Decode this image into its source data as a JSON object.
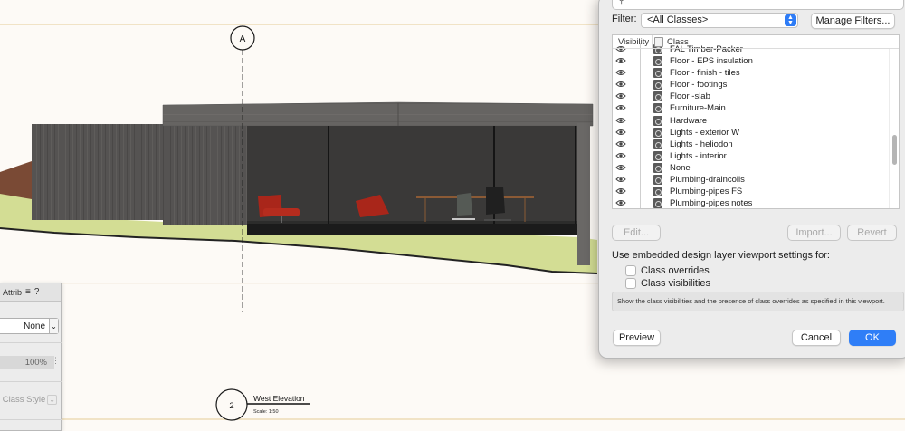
{
  "canvas": {
    "grid_bubble_label": "A",
    "view_marker_number": "2",
    "view_title": "West Elevation",
    "view_scale": "Scale: 1:50",
    "colors": {
      "background": "#fdfaf6",
      "guide_line": "#f1e3c6",
      "roof_concrete": "#646260",
      "wall_concrete": "#535150",
      "terrain_green": "#d3dd94",
      "terrain_brown": "#7a4a35",
      "chair_red": "#a9261a"
    }
  },
  "attributes_palette": {
    "title": "Attrib",
    "menu_icon": "hamburger-menu-icon",
    "help_label": "?",
    "fill_value": "None",
    "opacity_value": "100%",
    "class_style_label": "Class Style"
  },
  "dialog": {
    "filter_label": "Filter:",
    "filter_value": "<All Classes>",
    "manage_filters_label": "Manage Filters...",
    "list_header_visibility": "Visibility",
    "list_header_class": "Class",
    "classes": [
      {
        "name": "FAL Timber-Packer",
        "visible": true
      },
      {
        "name": "Floor - EPS insulation",
        "visible": true
      },
      {
        "name": "Floor - finish - tiles",
        "visible": true
      },
      {
        "name": "Floor - footings",
        "visible": true
      },
      {
        "name": "Floor -slab",
        "visible": true
      },
      {
        "name": "Furniture-Main",
        "visible": true
      },
      {
        "name": "Hardware",
        "visible": true
      },
      {
        "name": "Lights - exterior W",
        "visible": true
      },
      {
        "name": "Lights - heliodon",
        "visible": true
      },
      {
        "name": "Lights - interior",
        "visible": true
      },
      {
        "name": "None",
        "visible": true
      },
      {
        "name": "Plumbing-draincoils",
        "visible": true
      },
      {
        "name": "Plumbing-pipes FS",
        "visible": true
      },
      {
        "name": "Plumbing-pipes notes",
        "visible": true
      }
    ],
    "edit_label": "Edit...",
    "import_label": "Import...",
    "revert_label": "Revert",
    "embedded_label": "Use embedded design layer viewport settings for:",
    "class_overrides_label": "Class overrides",
    "class_visibilities_label": "Class visibilities",
    "info_text": "Show the class visibilities and the presence of class overrides as specified in this viewport.",
    "preview_label": "Preview",
    "cancel_label": "Cancel",
    "ok_label": "OK",
    "accent_color": "#2f7ef7"
  }
}
